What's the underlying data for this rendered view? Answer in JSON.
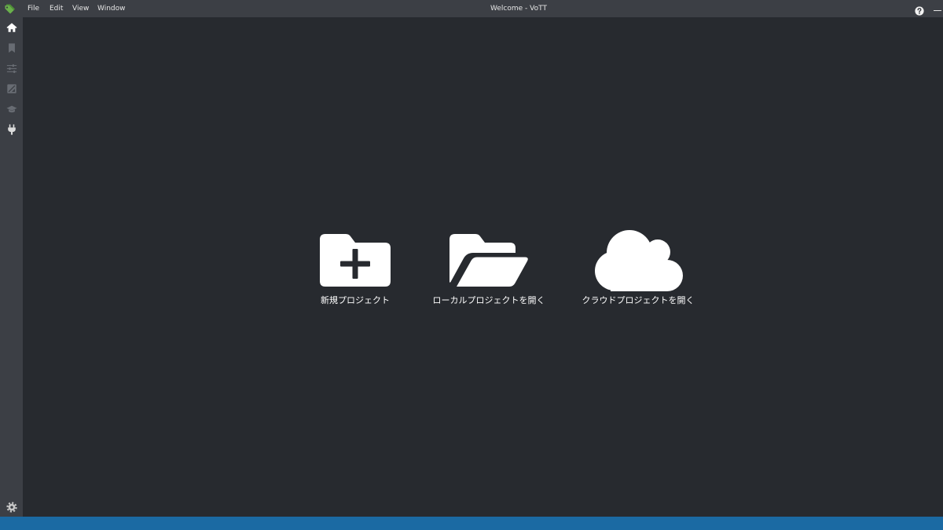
{
  "window": {
    "title": "Welcome - VoTT"
  },
  "menu": {
    "items": [
      "File",
      "Edit",
      "View",
      "Window"
    ]
  },
  "titlebar": {
    "logo_icon": "tag-logo-icon",
    "help_icon": "question-circle-icon",
    "minimize_icon": "minimize-icon"
  },
  "sidebar": {
    "items": [
      {
        "id": "home",
        "icon": "home-icon",
        "active": true
      },
      {
        "id": "tags",
        "icon": "bookmark-icon",
        "active": false
      },
      {
        "id": "settings",
        "icon": "sliders-icon",
        "active": false
      },
      {
        "id": "export",
        "icon": "image-icon",
        "active": false
      },
      {
        "id": "active-learning",
        "icon": "graduation-cap-icon",
        "active": false
      },
      {
        "id": "connections",
        "icon": "plug-icon",
        "active": false
      }
    ],
    "footer_icon": "gear-icon"
  },
  "actions": [
    {
      "label": "新規プロジェクト",
      "icon": "folder-plus-icon"
    },
    {
      "label": "ローカルプロジェクトを開く",
      "icon": "folder-open-icon"
    },
    {
      "label": "クラウドプロジェクトを開く",
      "icon": "cloud-icon"
    }
  ],
  "colors": {
    "chrome": "#3c3f45",
    "background": "#272a2f",
    "status_bar": "#1b6aa3",
    "logo": "#6ab04c",
    "icon_active": "#ffffff",
    "icon_inactive": "#686c73"
  }
}
